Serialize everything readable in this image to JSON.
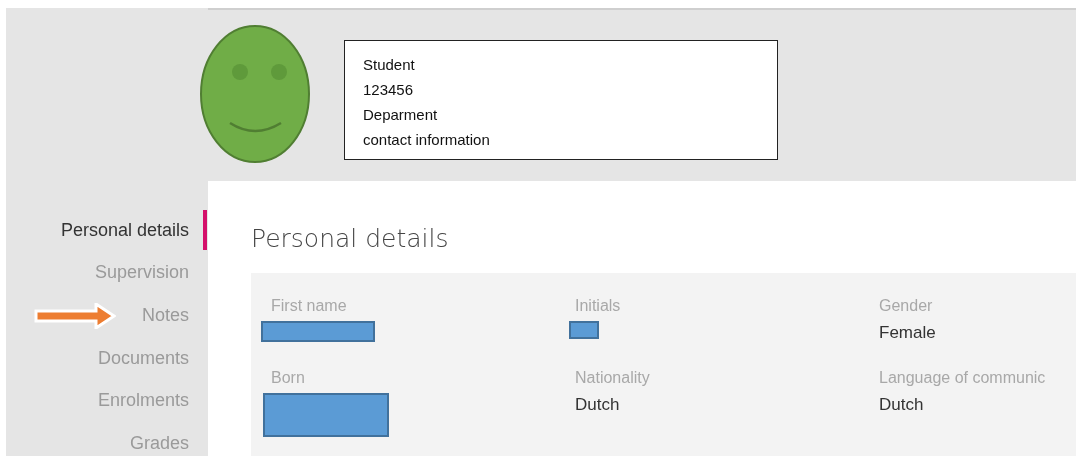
{
  "profile": {
    "info_lines": [
      "Student",
      "123456",
      "Deparment",
      "contact information"
    ]
  },
  "sidebar": {
    "items": [
      {
        "label": "Personal details",
        "selected": true,
        "annotated": false
      },
      {
        "label": "Supervision",
        "selected": false,
        "annotated": false
      },
      {
        "label": "Notes",
        "selected": false,
        "annotated": true
      },
      {
        "label": "Documents",
        "selected": false,
        "annotated": false
      },
      {
        "label": "Enrolments",
        "selected": false,
        "annotated": false
      },
      {
        "label": "Grades",
        "selected": false,
        "annotated": false
      }
    ]
  },
  "section": {
    "title": "Personal details",
    "fields": [
      {
        "label": "First name",
        "kind": "redacted"
      },
      {
        "label": "Initials",
        "kind": "redacted"
      },
      {
        "label": "Gender",
        "kind": "text",
        "value": "Female"
      },
      {
        "label": "Born",
        "kind": "redacted"
      },
      {
        "label": "Nationality",
        "kind": "text",
        "value": "Dutch"
      },
      {
        "label": "Language of communic",
        "kind": "text",
        "value": "Dutch"
      }
    ]
  }
}
